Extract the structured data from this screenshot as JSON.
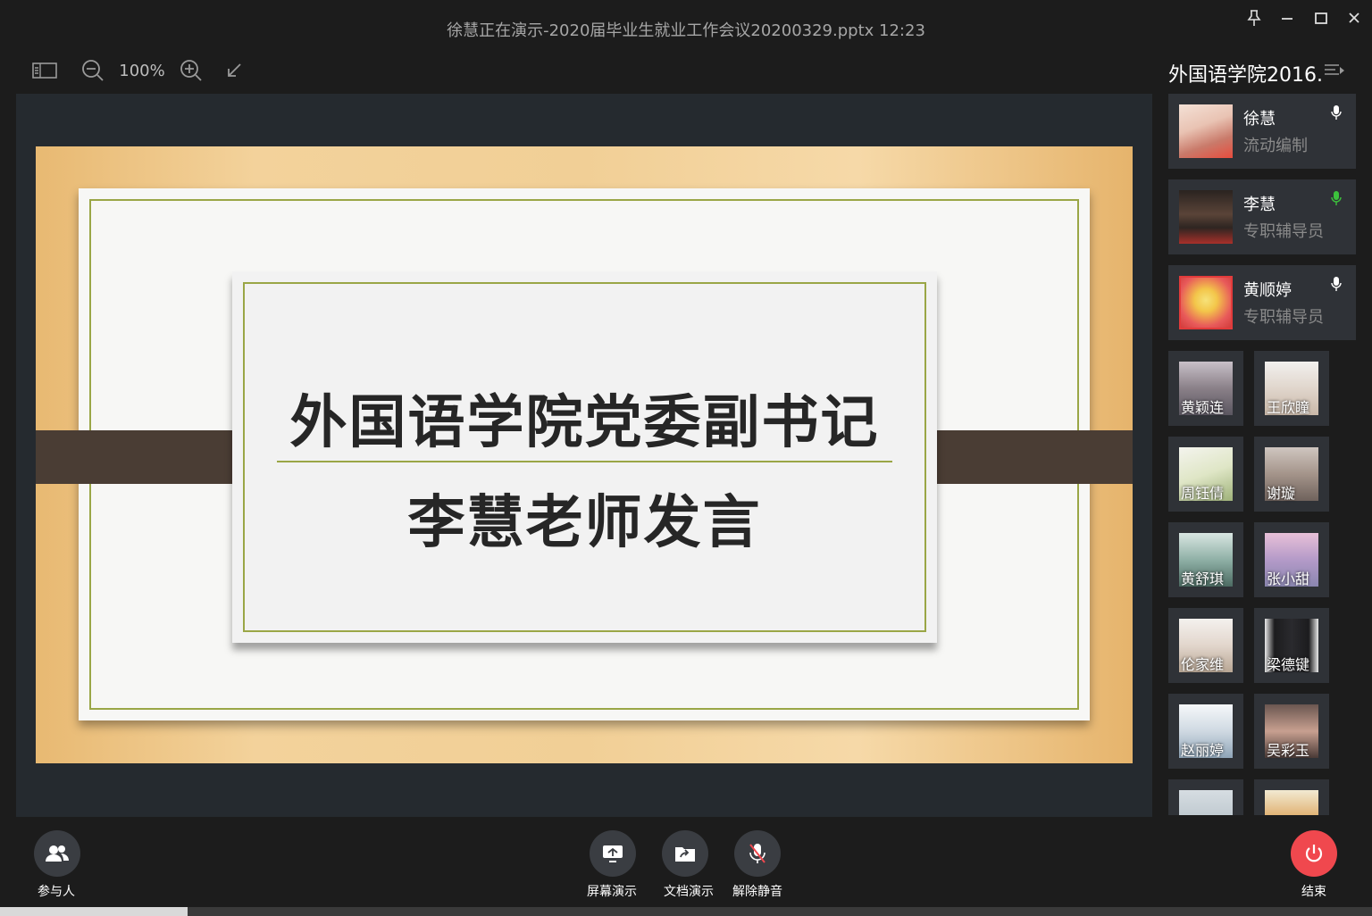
{
  "window": {
    "title": "徐慧正在演示-2020届毕业生就业工作会议20200329.pptx 12:23"
  },
  "toolbar": {
    "zoom": "100%"
  },
  "slide": {
    "title": "外国语学院党委副书记",
    "subtitle": "李慧老师发言"
  },
  "panel": {
    "title": "外国语学院2016..."
  },
  "speakers": [
    {
      "name": "徐慧",
      "role": "流动编制",
      "mic": "white"
    },
    {
      "name": "李慧",
      "role": "专职辅导员",
      "mic": "green"
    },
    {
      "name": "黄顺婷",
      "role": "专职辅导员",
      "mic": "white"
    }
  ],
  "participants": [
    {
      "name": "黄颖连"
    },
    {
      "name": "王欣瞳"
    },
    {
      "name": "周钰倩"
    },
    {
      "name": "谢璇"
    },
    {
      "name": "黄舒琪"
    },
    {
      "name": "张小甜"
    },
    {
      "name": "伦家维"
    },
    {
      "name": "梁德键"
    },
    {
      "name": "赵丽婷"
    },
    {
      "name": "吴彩玉"
    },
    {
      "name": ""
    },
    {
      "name": ""
    }
  ],
  "bottom": {
    "participants_label": "参与人",
    "screen_share_label": "屏幕演示",
    "doc_share_label": "文档演示",
    "unmute_label": "解除静音",
    "end_label": "结束"
  },
  "colors": {
    "accent_green": "#3cc13c",
    "end_red": "#f0484e",
    "slide_rule": "#9aa646"
  }
}
